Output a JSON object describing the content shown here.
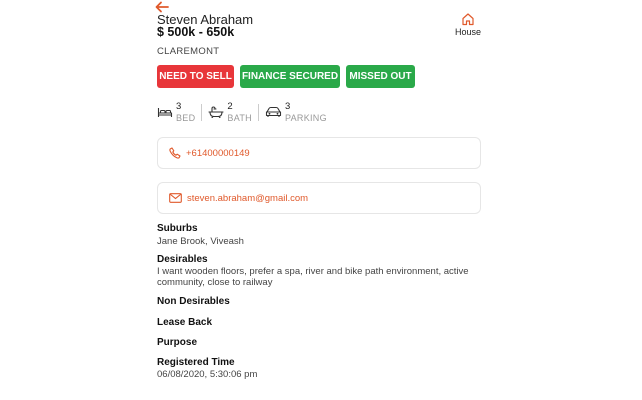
{
  "header": {
    "name": "Steven Abraham",
    "price": "$ 500k - 650k",
    "suburb": "CLAREMONT",
    "property_type": "House"
  },
  "tags": [
    {
      "label": "NEED TO SELL",
      "color": "#e8363a"
    },
    {
      "label": "FINANCE SECURED",
      "color": "#2aa949"
    },
    {
      "label": "MISSED OUT",
      "color": "#2aa949"
    }
  ],
  "features": {
    "bed": {
      "count": "3",
      "label": "BED",
      "icon": "bed-icon"
    },
    "bath": {
      "count": "2",
      "label": "BATH",
      "icon": "bath-icon"
    },
    "parking": {
      "count": "3",
      "label": "PARKING",
      "icon": "car-icon"
    }
  },
  "contact": {
    "phone": "+61400000149",
    "email": "steven.abraham@gmail.com"
  },
  "details": {
    "suburbs_title": "Suburbs",
    "suburbs_value": "Jane Brook, Viveash",
    "desirables_title": "Desirables",
    "desirables_value": "I want wooden floors, prefer a spa, river and bike path environment, active community, close to railway",
    "non_desirables_title": "Non Desirables",
    "lease_back_title": "Lease Back",
    "purpose_title": "Purpose",
    "registered_title": "Registered Time",
    "registered_value": "06/08/2020, 5:30:06 pm"
  },
  "colors": {
    "accent": "#e0592b",
    "need_to_sell": "#e8363a",
    "positive": "#2aa949"
  }
}
